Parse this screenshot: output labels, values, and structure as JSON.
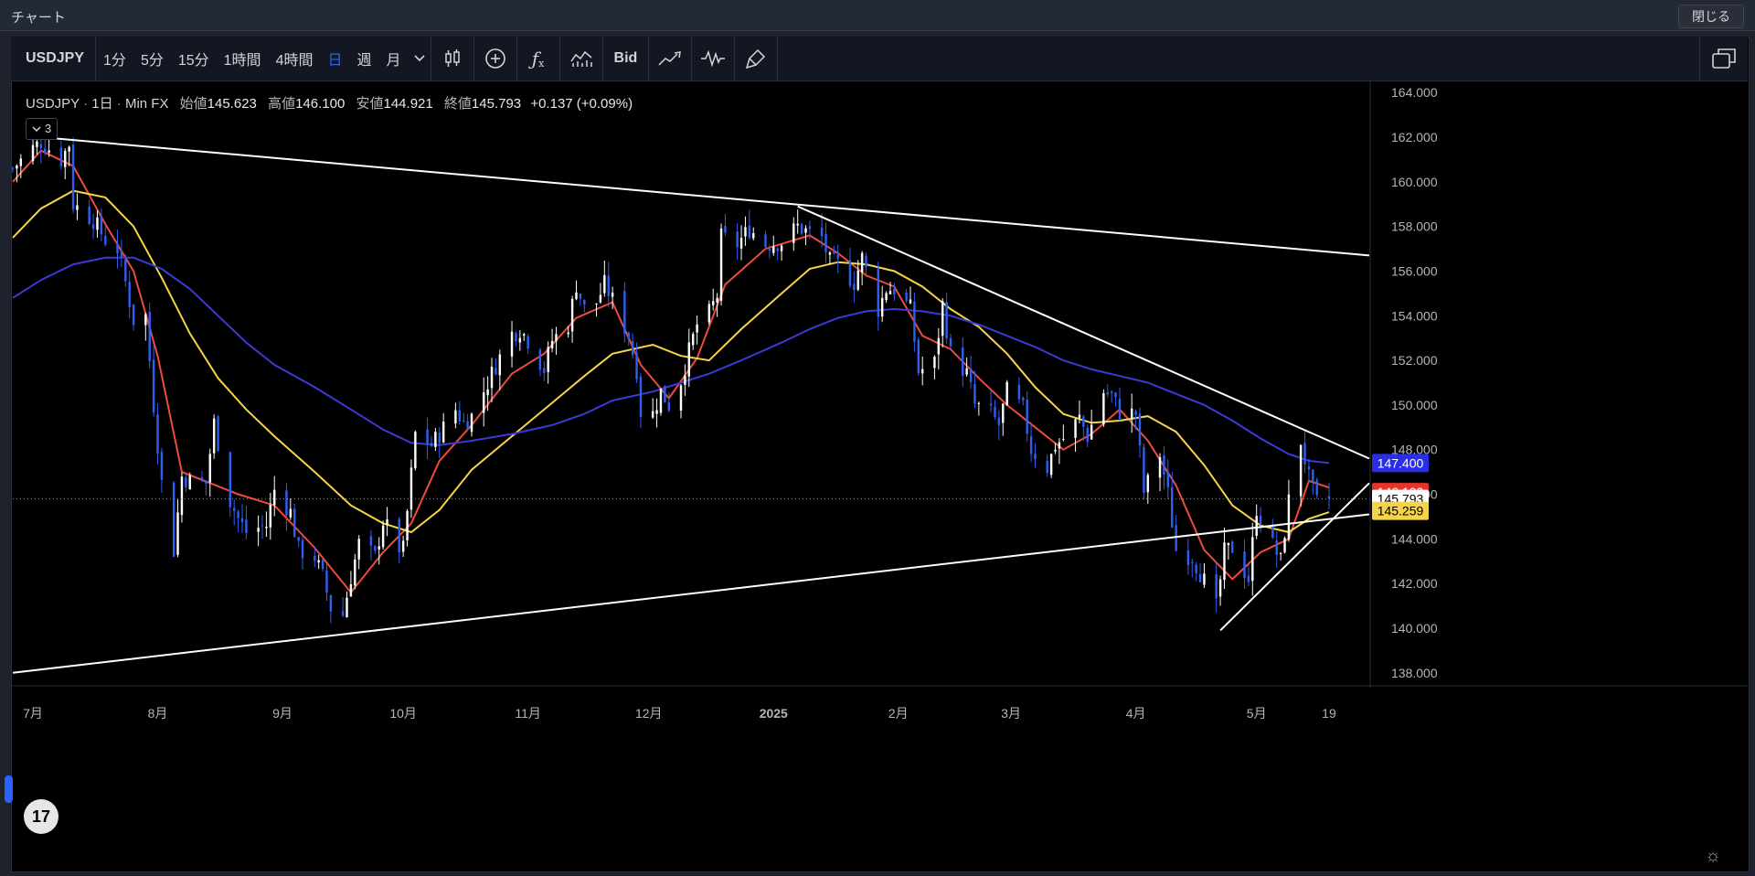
{
  "window": {
    "title": "チャート",
    "close_label": "閉じる"
  },
  "toolbar": {
    "symbol": "USDJPY",
    "intervals": [
      "1分",
      "5分",
      "15分",
      "1時間",
      "4時間",
      "日",
      "週",
      "月"
    ],
    "active_interval": "日",
    "bid_label": "Bid"
  },
  "legend": {
    "symbol": "USDJPY",
    "interval": "1日",
    "source": "Min FX",
    "open_label": "始値",
    "open": "145.623",
    "high_label": "高値",
    "high": "146.100",
    "low_label": "安値",
    "low": "144.921",
    "close_label": "終値",
    "close": "145.793",
    "change": "+0.137",
    "change_pct": "(+0.09%)",
    "indicator_toggle": "3"
  },
  "colors": {
    "up": "#ffffff",
    "down": "#2f5ef2",
    "ma_fast": "#ef4b3b",
    "ma_mid": "#f5d547",
    "ma_slow": "#3a3ad6",
    "trendline": "#ffffff"
  },
  "chart_data": {
    "type": "candlestick",
    "title": "",
    "ylim": [
      137.5,
      164.5
    ],
    "y_ticks": [
      "138.000",
      "140.000",
      "142.000",
      "144.000",
      "146.000",
      "148.000",
      "150.000",
      "152.000",
      "154.000",
      "156.000",
      "158.000",
      "160.000",
      "162.000",
      "164.000"
    ],
    "x_tick_labels": [
      {
        "label": "7月",
        "date": "2024-07-01"
      },
      {
        "label": "8月",
        "date": "2024-08-01"
      },
      {
        "label": "9月",
        "date": "2024-09-01"
      },
      {
        "label": "10月",
        "date": "2024-10-01"
      },
      {
        "label": "11月",
        "date": "2024-11-01"
      },
      {
        "label": "12月",
        "date": "2024-12-01"
      },
      {
        "label": "2025",
        "date": "2025-01-01"
      },
      {
        "label": "2月",
        "date": "2025-02-01"
      },
      {
        "label": "3月",
        "date": "2025-03-01"
      },
      {
        "label": "4月",
        "date": "2025-04-01"
      },
      {
        "label": "5月",
        "date": "2025-05-01"
      },
      {
        "label": "19",
        "date": "2025-05-19"
      }
    ],
    "x_range": [
      "2024-06-26",
      "2025-05-29"
    ],
    "close_path": [
      [
        "2024-06-26",
        160.6
      ],
      [
        "2024-07-01",
        161.5
      ],
      [
        "2024-07-03",
        161.8
      ],
      [
        "2024-07-08",
        161.0
      ],
      [
        "2024-07-10",
        161.7
      ],
      [
        "2024-07-11",
        159.0
      ],
      [
        "2024-07-16",
        158.3
      ],
      [
        "2024-07-19",
        157.4
      ],
      [
        "2024-07-22",
        157.0
      ],
      [
        "2024-07-24",
        155.5
      ],
      [
        "2024-07-26",
        153.8
      ],
      [
        "2024-07-29",
        154.0
      ],
      [
        "2024-07-31",
        150.0
      ],
      [
        "2024-08-02",
        146.5
      ],
      [
        "2024-08-05",
        143.5
      ],
      [
        "2024-08-07",
        146.8
      ],
      [
        "2024-08-09",
        146.6
      ],
      [
        "2024-08-13",
        146.5
      ],
      [
        "2024-08-15",
        149.2
      ],
      [
        "2024-08-19",
        145.7
      ],
      [
        "2024-08-21",
        144.9
      ],
      [
        "2024-08-23",
        144.3
      ],
      [
        "2024-08-26",
        144.5
      ],
      [
        "2024-08-28",
        144.6
      ],
      [
        "2024-08-30",
        146.2
      ],
      [
        "2024-09-03",
        145.2
      ],
      [
        "2024-09-05",
        143.5
      ],
      [
        "2024-09-09",
        143.2
      ],
      [
        "2024-09-11",
        142.3
      ],
      [
        "2024-09-13",
        140.9
      ],
      [
        "2024-09-16",
        140.6
      ],
      [
        "2024-09-18",
        142.3
      ],
      [
        "2024-09-20",
        143.8
      ],
      [
        "2024-09-24",
        143.2
      ],
      [
        "2024-09-26",
        144.8
      ],
      [
        "2024-09-30",
        143.6
      ],
      [
        "2024-10-01",
        143.5
      ],
      [
        "2024-10-03",
        146.9
      ],
      [
        "2024-10-04",
        148.7
      ],
      [
        "2024-10-08",
        148.2
      ],
      [
        "2024-10-10",
        148.7
      ],
      [
        "2024-10-14",
        149.8
      ],
      [
        "2024-10-16",
        149.2
      ],
      [
        "2024-10-18",
        149.5
      ],
      [
        "2024-10-22",
        151.0
      ],
      [
        "2024-10-24",
        151.8
      ],
      [
        "2024-10-28",
        153.2
      ],
      [
        "2024-10-30",
        153.4
      ],
      [
        "2024-11-01",
        152.9
      ],
      [
        "2024-11-05",
        151.6
      ],
      [
        "2024-11-07",
        152.9
      ],
      [
        "2024-11-11",
        153.6
      ],
      [
        "2024-11-13",
        155.4
      ],
      [
        "2024-11-15",
        154.3
      ],
      [
        "2024-11-18",
        154.6
      ],
      [
        "2024-11-20",
        155.4
      ],
      [
        "2024-11-22",
        154.7
      ],
      [
        "2024-11-26",
        153.1
      ],
      [
        "2024-11-28",
        151.6
      ],
      [
        "2024-11-29",
        149.7
      ],
      [
        "2024-12-02",
        149.6
      ],
      [
        "2024-12-04",
        150.6
      ],
      [
        "2024-12-06",
        150.0
      ],
      [
        "2024-12-09",
        151.1
      ],
      [
        "2024-12-11",
        152.4
      ],
      [
        "2024-12-13",
        153.6
      ],
      [
        "2024-12-16",
        154.1
      ],
      [
        "2024-12-18",
        154.9
      ],
      [
        "2024-12-19",
        157.5
      ],
      [
        "2024-12-23",
        157.2
      ],
      [
        "2024-12-26",
        157.9
      ],
      [
        "2024-12-30",
        157.2
      ],
      [
        "2025-01-03",
        157.3
      ],
      [
        "2025-01-07",
        158.0
      ],
      [
        "2025-01-10",
        157.7
      ],
      [
        "2025-01-13",
        157.5
      ],
      [
        "2025-01-15",
        156.4
      ],
      [
        "2025-01-17",
        156.3
      ],
      [
        "2025-01-21",
        155.5
      ],
      [
        "2025-01-23",
        156.6
      ],
      [
        "2025-01-27",
        154.3
      ],
      [
        "2025-01-29",
        155.2
      ],
      [
        "2025-01-31",
        155.2
      ],
      [
        "2025-02-04",
        154.3
      ],
      [
        "2025-02-06",
        151.5
      ],
      [
        "2025-02-10",
        151.9
      ],
      [
        "2025-02-12",
        154.5
      ],
      [
        "2025-02-14",
        152.3
      ],
      [
        "2025-02-18",
        151.4
      ],
      [
        "2025-02-20",
        150.0
      ],
      [
        "2025-02-24",
        149.6
      ],
      [
        "2025-02-26",
        149.1
      ],
      [
        "2025-02-28",
        150.6
      ],
      [
        "2025-03-04",
        149.8
      ],
      [
        "2025-03-06",
        148.0
      ],
      [
        "2025-03-10",
        147.2
      ],
      [
        "2025-03-12",
        148.2
      ],
      [
        "2025-03-14",
        148.5
      ],
      [
        "2025-03-18",
        149.4
      ],
      [
        "2025-03-20",
        148.6
      ],
      [
        "2025-03-24",
        150.6
      ],
      [
        "2025-03-26",
        150.4
      ],
      [
        "2025-03-28",
        149.7
      ],
      [
        "2025-04-01",
        149.6
      ],
      [
        "2025-04-03",
        146.1
      ],
      [
        "2025-04-07",
        147.8
      ],
      [
        "2025-04-09",
        146.0
      ],
      [
        "2025-04-11",
        143.5
      ],
      [
        "2025-04-15",
        143.2
      ],
      [
        "2025-04-17",
        142.5
      ],
      [
        "2025-04-21",
        140.9
      ],
      [
        "2025-04-23",
        143.4
      ],
      [
        "2025-04-25",
        143.6
      ],
      [
        "2025-04-29",
        142.2
      ],
      [
        "2025-05-01",
        145.4
      ],
      [
        "2025-05-05",
        143.7
      ],
      [
        "2025-05-07",
        143.0
      ],
      [
        "2025-05-09",
        145.7
      ],
      [
        "2025-05-12",
        148.4
      ],
      [
        "2025-05-14",
        146.7
      ],
      [
        "2025-05-16",
        145.6
      ],
      [
        "2025-05-19",
        145.8
      ]
    ],
    "moving_averages": [
      {
        "key": "ma_fast",
        "points": [
          [
            "2024-06-26",
            160.0
          ],
          [
            "2024-07-03",
            161.4
          ],
          [
            "2024-07-11",
            160.7
          ],
          [
            "2024-07-19",
            158.1
          ],
          [
            "2024-07-26",
            156.0
          ],
          [
            "2024-08-01",
            152.2
          ],
          [
            "2024-08-07",
            147.0
          ],
          [
            "2024-08-14",
            146.5
          ],
          [
            "2024-08-21",
            146.0
          ],
          [
            "2024-08-30",
            145.5
          ],
          [
            "2024-09-09",
            143.6
          ],
          [
            "2024-09-18",
            141.6
          ],
          [
            "2024-09-26",
            143.4
          ],
          [
            "2024-10-03",
            144.7
          ],
          [
            "2024-10-10",
            147.5
          ],
          [
            "2024-10-18",
            149.1
          ],
          [
            "2024-10-28",
            151.4
          ],
          [
            "2024-11-05",
            152.3
          ],
          [
            "2024-11-13",
            153.9
          ],
          [
            "2024-11-22",
            154.6
          ],
          [
            "2024-11-29",
            151.8
          ],
          [
            "2024-12-06",
            150.3
          ],
          [
            "2024-12-13",
            152.1
          ],
          [
            "2024-12-20",
            155.4
          ],
          [
            "2024-12-30",
            157.0
          ],
          [
            "2025-01-10",
            157.6
          ],
          [
            "2025-01-17",
            156.8
          ],
          [
            "2025-01-24",
            155.8
          ],
          [
            "2025-01-31",
            155.3
          ],
          [
            "2025-02-07",
            153.1
          ],
          [
            "2025-02-14",
            152.5
          ],
          [
            "2025-02-21",
            151.2
          ],
          [
            "2025-02-28",
            150.0
          ],
          [
            "2025-03-07",
            149.0
          ],
          [
            "2025-03-14",
            148.0
          ],
          [
            "2025-03-21",
            148.7
          ],
          [
            "2025-03-28",
            149.8
          ],
          [
            "2025-04-04",
            148.4
          ],
          [
            "2025-04-11",
            146.4
          ],
          [
            "2025-04-18",
            143.5
          ],
          [
            "2025-04-25",
            142.2
          ],
          [
            "2025-05-02",
            143.4
          ],
          [
            "2025-05-09",
            144.0
          ],
          [
            "2025-05-14",
            146.6
          ],
          [
            "2025-05-19",
            146.3
          ]
        ]
      },
      {
        "key": "ma_mid",
        "points": [
          [
            "2024-06-26",
            157.5
          ],
          [
            "2024-07-03",
            158.8
          ],
          [
            "2024-07-11",
            159.6
          ],
          [
            "2024-07-19",
            159.3
          ],
          [
            "2024-07-26",
            158.0
          ],
          [
            "2024-08-02",
            155.7
          ],
          [
            "2024-08-09",
            153.2
          ],
          [
            "2024-08-16",
            151.2
          ],
          [
            "2024-08-23",
            149.8
          ],
          [
            "2024-08-30",
            148.6
          ],
          [
            "2024-09-09",
            147.0
          ],
          [
            "2024-09-18",
            145.5
          ],
          [
            "2024-09-26",
            144.7
          ],
          [
            "2024-10-03",
            144.3
          ],
          [
            "2024-10-10",
            145.3
          ],
          [
            "2024-10-18",
            147.1
          ],
          [
            "2024-10-28",
            148.6
          ],
          [
            "2024-11-07",
            150.1
          ],
          [
            "2024-11-15",
            151.3
          ],
          [
            "2024-11-22",
            152.3
          ],
          [
            "2024-12-02",
            152.7
          ],
          [
            "2024-12-09",
            152.2
          ],
          [
            "2024-12-16",
            152.0
          ],
          [
            "2024-12-24",
            153.4
          ],
          [
            "2025-01-03",
            155.0
          ],
          [
            "2025-01-10",
            156.1
          ],
          [
            "2025-01-17",
            156.4
          ],
          [
            "2025-01-24",
            156.3
          ],
          [
            "2025-01-31",
            156.0
          ],
          [
            "2025-02-07",
            155.3
          ],
          [
            "2025-02-14",
            154.3
          ],
          [
            "2025-02-21",
            153.5
          ],
          [
            "2025-02-28",
            152.3
          ],
          [
            "2025-03-07",
            150.8
          ],
          [
            "2025-03-14",
            149.6
          ],
          [
            "2025-03-21",
            149.2
          ],
          [
            "2025-03-28",
            149.3
          ],
          [
            "2025-04-04",
            149.5
          ],
          [
            "2025-04-11",
            148.8
          ],
          [
            "2025-04-18",
            147.3
          ],
          [
            "2025-04-25",
            145.5
          ],
          [
            "2025-05-02",
            144.6
          ],
          [
            "2025-05-09",
            144.3
          ],
          [
            "2025-05-14",
            144.9
          ],
          [
            "2025-05-19",
            145.2
          ]
        ]
      },
      {
        "key": "ma_slow",
        "points": [
          [
            "2024-06-26",
            154.8
          ],
          [
            "2024-07-03",
            155.6
          ],
          [
            "2024-07-11",
            156.3
          ],
          [
            "2024-07-19",
            156.6
          ],
          [
            "2024-07-26",
            156.6
          ],
          [
            "2024-08-02",
            156.1
          ],
          [
            "2024-08-09",
            155.2
          ],
          [
            "2024-08-16",
            154.0
          ],
          [
            "2024-08-23",
            152.8
          ],
          [
            "2024-08-30",
            151.8
          ],
          [
            "2024-09-09",
            150.8
          ],
          [
            "2024-09-18",
            149.8
          ],
          [
            "2024-09-26",
            148.9
          ],
          [
            "2024-10-03",
            148.3
          ],
          [
            "2024-10-10",
            148.2
          ],
          [
            "2024-10-18",
            148.4
          ],
          [
            "2024-10-28",
            148.7
          ],
          [
            "2024-11-07",
            149.1
          ],
          [
            "2024-11-15",
            149.6
          ],
          [
            "2024-11-22",
            150.2
          ],
          [
            "2024-12-02",
            150.6
          ],
          [
            "2024-12-09",
            151.0
          ],
          [
            "2024-12-16",
            151.4
          ],
          [
            "2024-12-24",
            152.0
          ],
          [
            "2025-01-03",
            152.8
          ],
          [
            "2025-01-10",
            153.4
          ],
          [
            "2025-01-17",
            153.9
          ],
          [
            "2025-01-24",
            154.2
          ],
          [
            "2025-01-31",
            154.3
          ],
          [
            "2025-02-07",
            154.2
          ],
          [
            "2025-02-14",
            154.0
          ],
          [
            "2025-02-21",
            153.6
          ],
          [
            "2025-02-28",
            153.1
          ],
          [
            "2025-03-07",
            152.6
          ],
          [
            "2025-03-14",
            152.0
          ],
          [
            "2025-03-21",
            151.6
          ],
          [
            "2025-03-28",
            151.3
          ],
          [
            "2025-04-04",
            151.0
          ],
          [
            "2025-04-11",
            150.5
          ],
          [
            "2025-04-18",
            150.0
          ],
          [
            "2025-04-25",
            149.3
          ],
          [
            "2025-05-02",
            148.5
          ],
          [
            "2025-05-09",
            147.8
          ],
          [
            "2025-05-14",
            147.5
          ],
          [
            "2025-05-19",
            147.4
          ]
        ]
      }
    ],
    "trendlines": [
      {
        "from": [
          "2024-07-03",
          162.0
        ],
        "to": [
          "2025-05-29",
          156.7
        ]
      },
      {
        "from": [
          "2025-01-07",
          158.9
        ],
        "to": [
          "2025-05-29",
          147.6
        ]
      },
      {
        "from": [
          "2024-06-26",
          138.0
        ],
        "to": [
          "2025-05-29",
          145.1
        ]
      },
      {
        "from": [
          "2025-04-22",
          139.9
        ],
        "to": [
          "2025-05-29",
          146.5
        ]
      }
    ],
    "price_labels": [
      {
        "value": 147.4,
        "text": "147.400",
        "bg": "#2a2ee6",
        "fg": "#ffffff"
      },
      {
        "value": 146.1,
        "text": "146.100",
        "bg": "#e8322a",
        "fg": "#ffffff"
      },
      {
        "value": 145.793,
        "text": "145.793",
        "bg": "#ffffff",
        "fg": "#000000"
      },
      {
        "value": 145.259,
        "text": "145.259",
        "bg": "#f5d547",
        "fg": "#000000"
      }
    ],
    "last_price": 145.793
  }
}
